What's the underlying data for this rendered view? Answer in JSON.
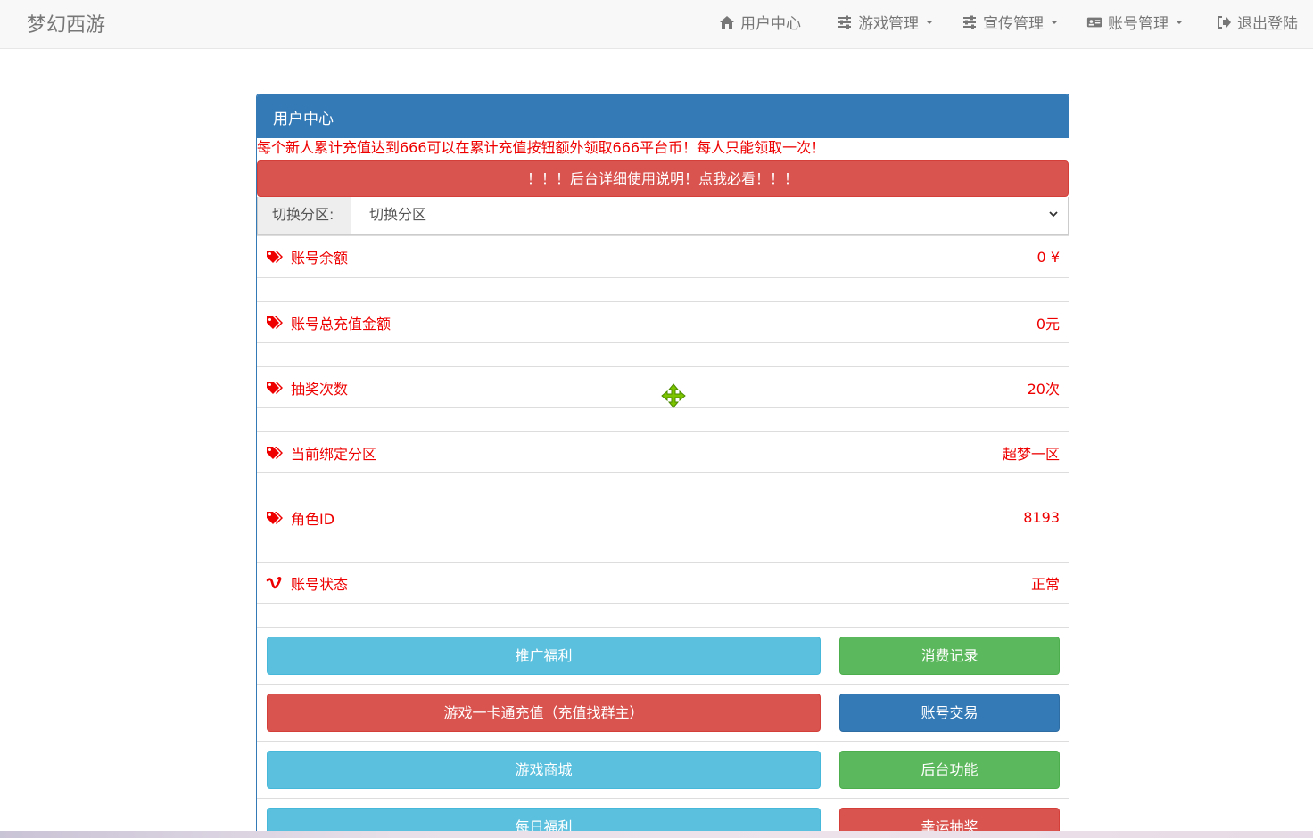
{
  "navbar": {
    "brand": "梦幻西游",
    "items": [
      {
        "label": "用户中心",
        "icon": "home-icon",
        "dropdown": false
      },
      {
        "label": "游戏管理",
        "icon": "sliders-icon",
        "dropdown": true
      },
      {
        "label": "宣传管理",
        "icon": "sliders-icon",
        "dropdown": true
      },
      {
        "label": "账号管理",
        "icon": "id-card-icon",
        "dropdown": true
      },
      {
        "label": "退出登陆",
        "icon": "sign-out-icon",
        "dropdown": false
      }
    ]
  },
  "panel": {
    "title": "用户中心",
    "notice": "每个新人累计充值达到666可以在累计充值按钮额外领取666平台币！每人只能领取一次！",
    "help_button": "！！！后台详细使用说明！点我必看！！！",
    "zone": {
      "label": "切换分区:",
      "selected": "切换分区"
    },
    "info": [
      {
        "label": "账号余额",
        "value": "0 ¥",
        "icon": "tags-icon"
      },
      {
        "label": "账号总充值金额",
        "value": "0元",
        "icon": "tags-icon"
      },
      {
        "label": "抽奖次数",
        "value": "20次",
        "icon": "tags-icon"
      },
      {
        "label": "当前绑定分区",
        "value": "超梦一区",
        "icon": "tags-icon"
      },
      {
        "label": "角色ID",
        "value": "8193",
        "icon": "tags-icon"
      },
      {
        "label": "账号状态",
        "value": "正常",
        "icon": "vimeo-icon"
      }
    ],
    "buttons": [
      [
        {
          "label": "推广福利",
          "color": "#5bc0de"
        },
        {
          "label": "消费记录",
          "color": "#5cb85c"
        }
      ],
      [
        {
          "label": "游戏一卡通充值（充值找群主）",
          "color": "#d9534f"
        },
        {
          "label": "账号交易",
          "color": "#337ab7"
        }
      ],
      [
        {
          "label": "游戏商城",
          "color": "#5bc0de"
        },
        {
          "label": "后台功能",
          "color": "#5cb85c"
        }
      ],
      [
        {
          "label": "每日福利",
          "color": "#5bc0de"
        },
        {
          "label": "幸运抽奖",
          "color": "#d9534f"
        }
      ]
    ]
  },
  "colors": {
    "primary": "#337ab7",
    "danger": "#d9534f",
    "info": "#5bc0de",
    "success": "#5cb85c",
    "text_red": "#ee0000"
  }
}
